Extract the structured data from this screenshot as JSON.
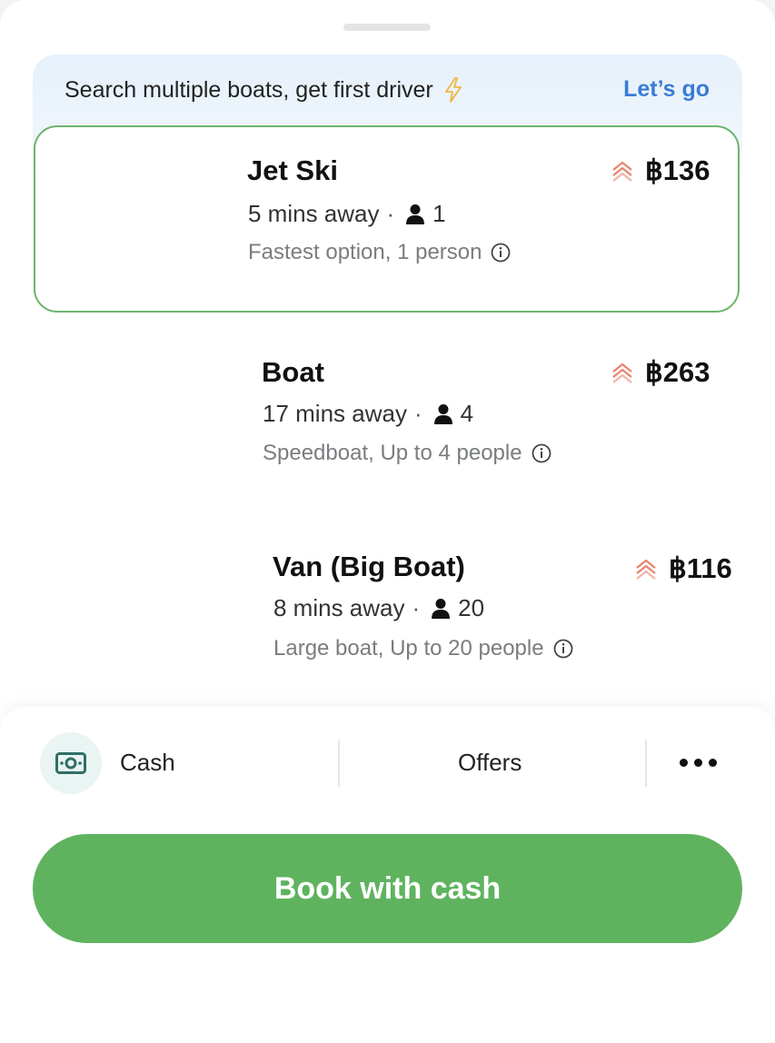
{
  "banner": {
    "text": "Search multiple boats, get first driver",
    "cta": "Let’s go",
    "icon": "lightning-bolt-icon"
  },
  "options": [
    {
      "name": "Jet Ski",
      "eta": "5 mins away",
      "capacity": "1",
      "description": "Fastest option, 1 person",
      "price": "฿136",
      "selected": true,
      "image": "jet-ski-image"
    },
    {
      "name": "Boat",
      "eta": "17 mins away",
      "capacity": "4",
      "description": "Speedboat, Up to 4 people",
      "price": "฿263",
      "selected": false,
      "image": "speedboat-image"
    },
    {
      "name": "Van (Big Boat)",
      "eta": "8 mins away",
      "capacity": "20",
      "description": "Large boat, Up to 20 people",
      "price": "฿116",
      "selected": false,
      "image": "ferry-image"
    }
  ],
  "separator": "·",
  "payment": {
    "method": "Cash",
    "icon": "cash-icon",
    "offers": "Offers",
    "more_icon": "more-dots-icon"
  },
  "book_button": "Book with cash",
  "colors": {
    "accent_green": "#5fb35f",
    "link_blue": "#3a7bd5",
    "surge": "#e8826d",
    "selected_border": "#6cb46f"
  }
}
